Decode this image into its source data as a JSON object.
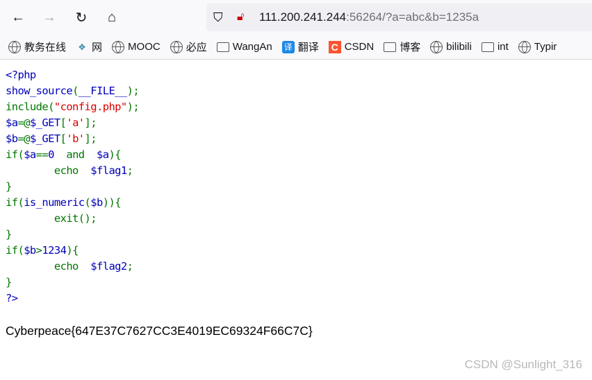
{
  "browser": {
    "url_host": "111.200.241.244",
    "url_rest": ":56264/?a=abc&b=1235a",
    "bookmarks": [
      {
        "label": "教务在线",
        "icon": "globe-icon"
      },
      {
        "label": "网",
        "icon": "site-logo-icon"
      },
      {
        "label": "MOOC",
        "icon": "globe-icon"
      },
      {
        "label": "必应",
        "icon": "globe-icon"
      },
      {
        "label": "WangAn",
        "icon": "folder-icon"
      },
      {
        "label": "翻译",
        "icon": "translate-icon"
      },
      {
        "label": "CSDN",
        "icon": "csdn-icon"
      },
      {
        "label": "博客",
        "icon": "folder-icon"
      },
      {
        "label": "bilibili",
        "icon": "globe-icon"
      },
      {
        "label": "int",
        "icon": "folder-icon"
      },
      {
        "label": "Typir",
        "icon": "globe-icon"
      }
    ]
  },
  "code": [
    [
      [
        "<?php",
        "d"
      ]
    ],
    [
      [
        "show_source",
        "d"
      ],
      [
        "(",
        "k"
      ],
      [
        "__FILE__",
        "d"
      ],
      [
        ");",
        "k"
      ]
    ],
    [
      [
        "include(",
        "k"
      ],
      [
        "\"config.php\"",
        "s"
      ],
      [
        ");",
        "k"
      ]
    ],
    [
      [
        "$a",
        "d"
      ],
      [
        "=@",
        "k"
      ],
      [
        "$_GET",
        "d"
      ],
      [
        "[",
        "k"
      ],
      [
        "'a'",
        "s"
      ],
      [
        "];",
        "k"
      ]
    ],
    [
      [
        "$b",
        "d"
      ],
      [
        "=@",
        "k"
      ],
      [
        "$_GET",
        "d"
      ],
      [
        "[",
        "k"
      ],
      [
        "'b'",
        "s"
      ],
      [
        "];",
        "k"
      ]
    ],
    [
      [
        "if(",
        "k"
      ],
      [
        "$a",
        "d"
      ],
      [
        "==",
        "k"
      ],
      [
        "0",
        "d"
      ],
      [
        "  and  ",
        "k"
      ],
      [
        "$a",
        "d"
      ],
      [
        "){",
        "k"
      ]
    ],
    [
      [
        "        echo  ",
        "k"
      ],
      [
        "$flag1",
        "d"
      ],
      [
        ";",
        "k"
      ]
    ],
    [
      [
        "}",
        "k"
      ]
    ],
    [
      [
        "if(",
        "k"
      ],
      [
        "is_numeric",
        "d"
      ],
      [
        "(",
        "k"
      ],
      [
        "$b",
        "d"
      ],
      [
        ")){",
        "k"
      ]
    ],
    [
      [
        "        exit",
        "k"
      ],
      [
        "();",
        "k"
      ]
    ],
    [
      [
        "}",
        "k"
      ]
    ],
    [
      [
        "if(",
        "k"
      ],
      [
        "$b",
        "d"
      ],
      [
        ">",
        "k"
      ],
      [
        "1234",
        "d"
      ],
      [
        "){",
        "k"
      ]
    ],
    [
      [
        "        echo  ",
        "k"
      ],
      [
        "$flag2",
        "d"
      ],
      [
        ";",
        "k"
      ]
    ],
    [
      [
        "}",
        "k"
      ]
    ],
    [
      [
        "?>",
        "d"
      ]
    ]
  ],
  "flag_output": "Cyberpeace{647E37C7627CC3E4019EC69324F66C7C}",
  "watermark": "CSDN @Sunlight_316"
}
